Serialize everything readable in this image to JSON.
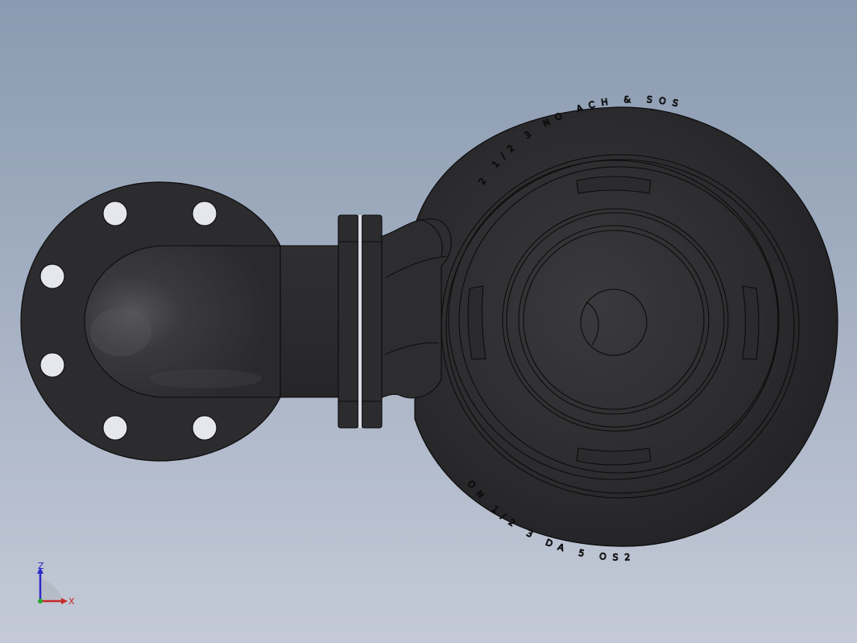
{
  "viewport": {
    "background_top": "#8a9ab0",
    "background_bottom": "#c4cad7"
  },
  "model": {
    "body_color": "#2b2b2d",
    "edge_color": "#0c0c0d",
    "casting_text_top": "2 1/2 3 NO ACH & SOS",
    "casting_text_bottom": "ON 1/2 3 DA 5 OS2"
  },
  "triad": {
    "z_label": "Z",
    "x_label": "X",
    "z_color": "#2a2ac8",
    "x_color": "#c82a2a",
    "y_color": "#2aa82a"
  }
}
